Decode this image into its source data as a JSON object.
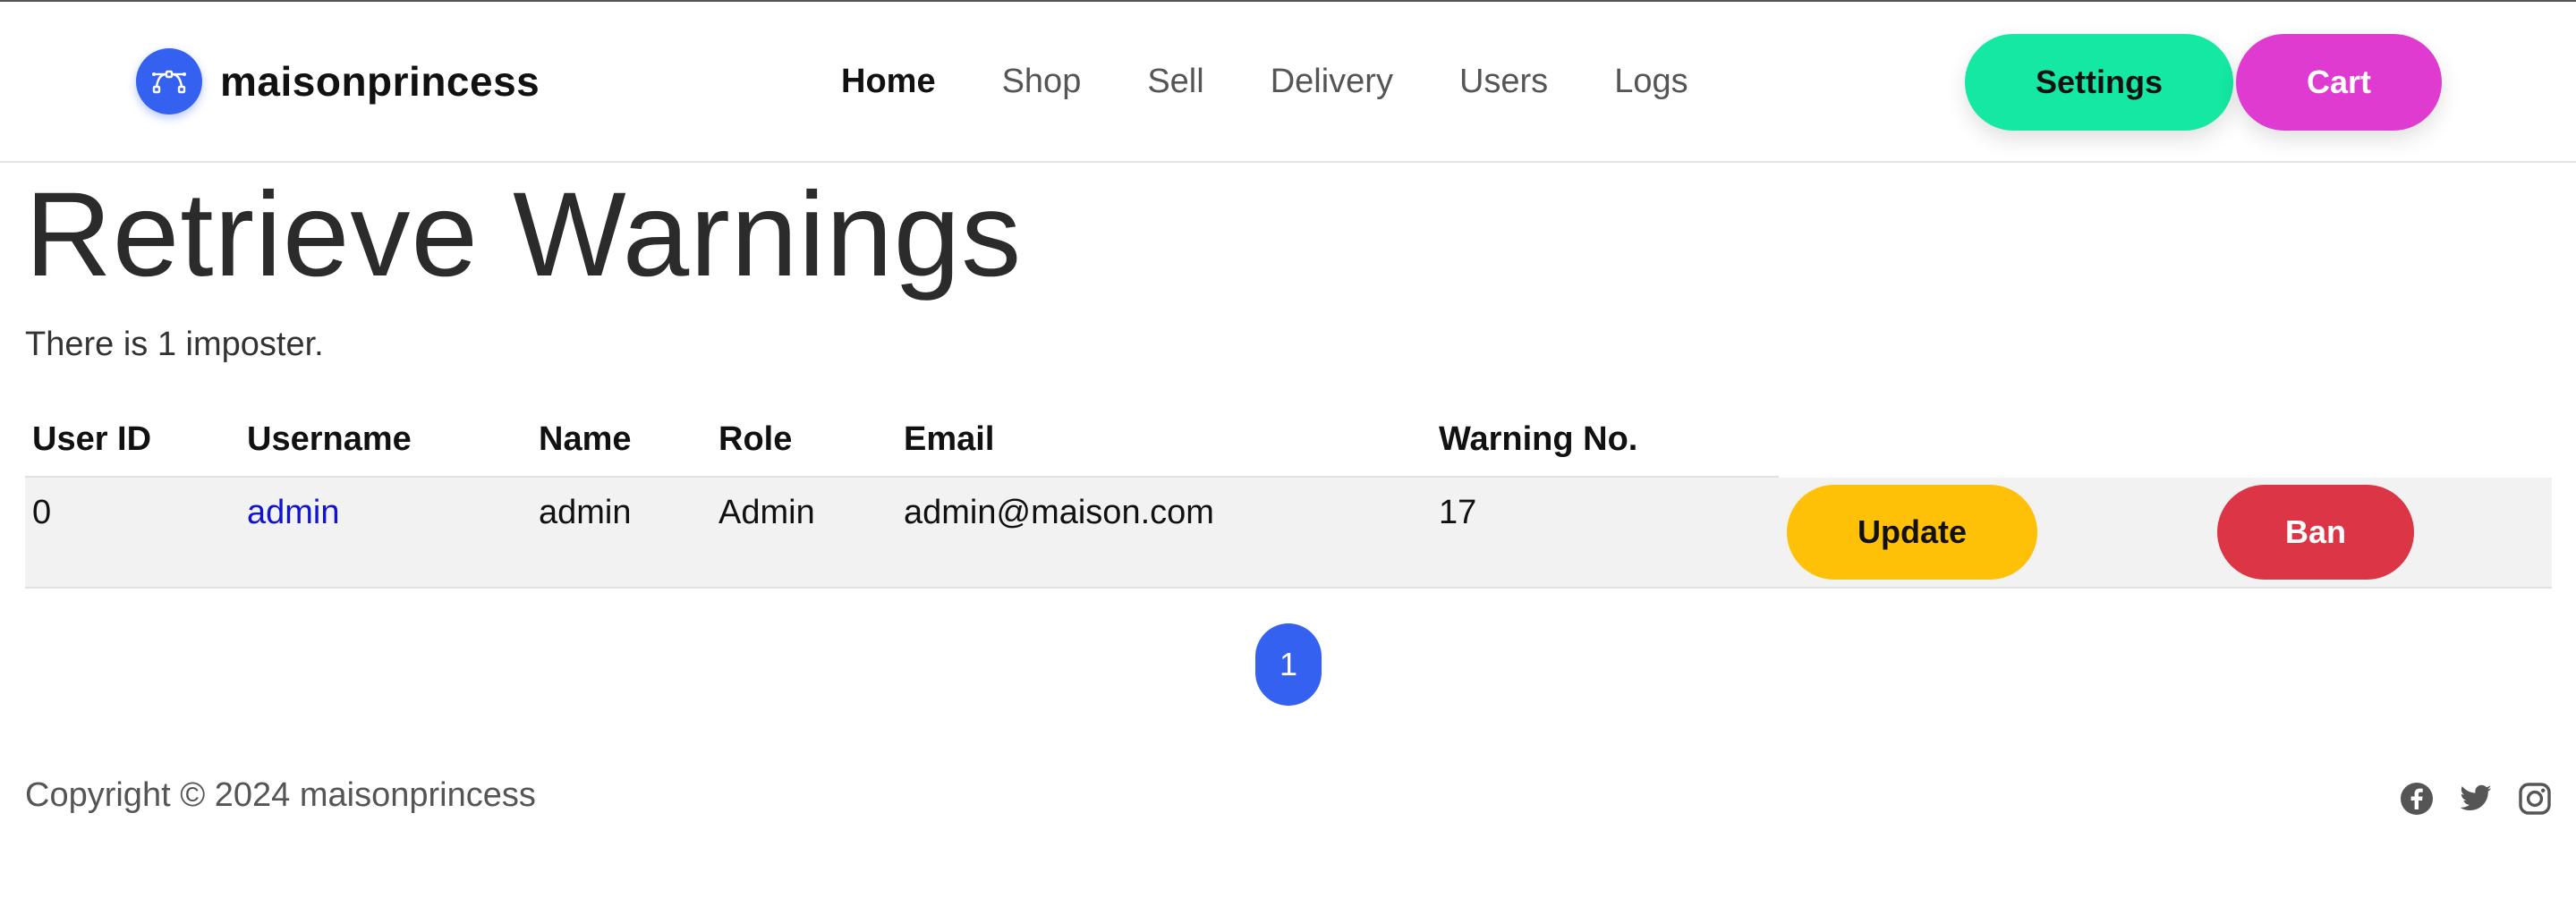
{
  "header": {
    "brand_name": "maisonprincess",
    "brand_icon": "bezier-curve-icon",
    "nav": [
      {
        "label": "Home",
        "active": true
      },
      {
        "label": "Shop",
        "active": false
      },
      {
        "label": "Sell",
        "active": false
      },
      {
        "label": "Delivery",
        "active": false
      },
      {
        "label": "Users",
        "active": false
      },
      {
        "label": "Logs",
        "active": false
      }
    ],
    "settings_label": "Settings",
    "cart_label": "Cart"
  },
  "main": {
    "title": "Retrieve Warnings",
    "summary": "There is 1 imposter."
  },
  "table": {
    "columns": [
      "User ID",
      "Username",
      "Name",
      "Role",
      "Email",
      "Warning No."
    ],
    "rows": [
      {
        "user_id": "0",
        "username": "admin",
        "name": "admin",
        "role": "Admin",
        "email": "admin@maison.com",
        "warning_no": "17",
        "update_label": "Update",
        "ban_label": "Ban"
      }
    ]
  },
  "pagination": {
    "current_page": "1"
  },
  "footer": {
    "copyright": "Copyright © 2024 maisonprincess",
    "social_icons": [
      "facebook-icon",
      "twitter-icon",
      "instagram-icon"
    ]
  },
  "colors": {
    "primary": "#3461f0",
    "settings": "#14e8a3",
    "cart": "#e03bd1",
    "update": "#ffc107",
    "ban": "#dc3545",
    "link": "#1212d4"
  }
}
